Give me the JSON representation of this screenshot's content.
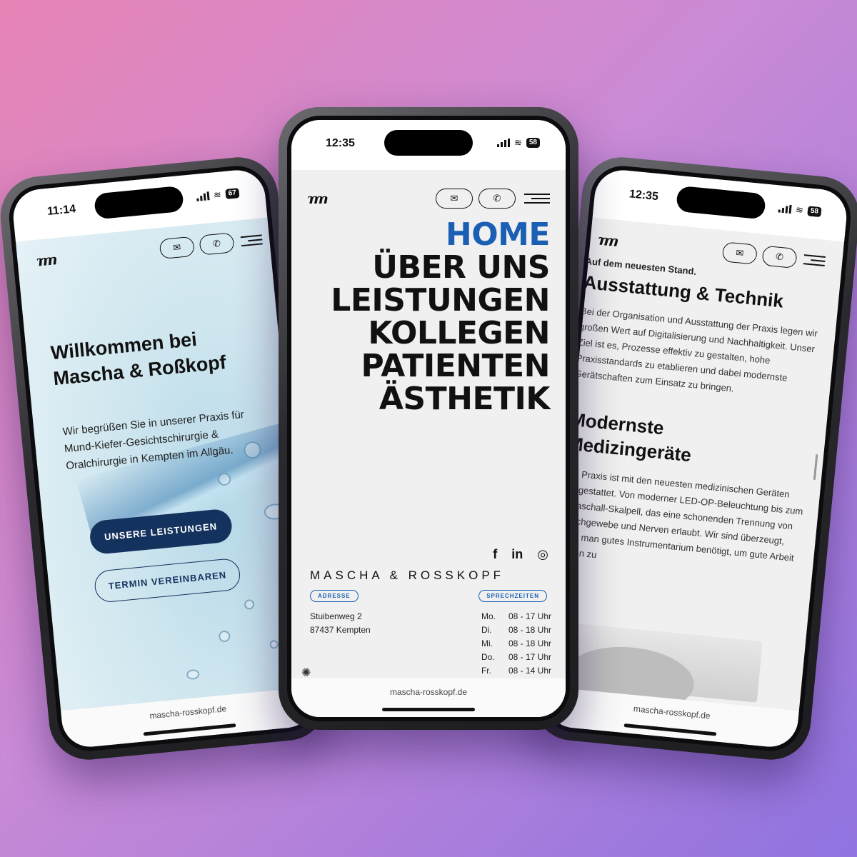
{
  "background": {
    "gradient_from": "#e784b6",
    "gradient_to": "#8f73e0"
  },
  "phones": {
    "left": {
      "status_time": "11:14",
      "battery": "67",
      "logo_text": "ɿɿɿɿ",
      "title_line1": "Willkommen bei",
      "title_line2": "Mascha & Roßkopf",
      "intro": "Wir begrüßen Sie in unserer Praxis für Mund-Kiefer-Gesichtschirurgie & Oralchirurgie in Kempten im Allgäu.",
      "primary_button": "UNSERE LEISTUNGEN",
      "secondary_button": "TERMIN VEREINBAREN",
      "url": "mascha-rosskopf.de"
    },
    "center": {
      "status_time": "12:35",
      "battery": "58",
      "logo_text": "ɿɿɿɿ",
      "nav": [
        "HOME",
        "ÜBER UNS",
        "LEISTUNGEN",
        "KOLLEGEN",
        "PATIENTEN",
        "ÄSTHETIK"
      ],
      "active_nav": "HOME",
      "accent_color": "#1a5fb4",
      "social": [
        "f",
        "in",
        "◎"
      ],
      "brand": "MASCHA & ROSSKOPF",
      "address_badge": "ADRESSE",
      "hours_badge": "SPRECHZEITEN",
      "address_line1": "Stuibenweg 2",
      "address_line2": "87437 Kempten",
      "hours": [
        {
          "day": "Mo.",
          "time": "08 - 17 Uhr"
        },
        {
          "day": "Di.",
          "time": "08 - 18 Uhr"
        },
        {
          "day": "Mi.",
          "time": "08 - 18 Uhr"
        },
        {
          "day": "Do.",
          "time": "08 - 17 Uhr"
        },
        {
          "day": "Fr.",
          "time": "08 - 14 Uhr"
        }
      ],
      "url": "mascha-rosskopf.de"
    },
    "right": {
      "status_time": "12:35",
      "battery": "58",
      "logo_text": "ɿɿɿɿ",
      "kicker": "Auf dem neuesten Stand.",
      "heading": "Ausstattung & Technik",
      "paragraph1": "Bei der Organisation und Ausstattung der Praxis legen wir großen Wert auf Digitalisierung und Nachhaltigkeit. Unser Ziel ist es, Prozesse effektiv zu gestalten, hohe Praxisstandards zu etablieren und dabei modernste Gerätschaften zum Einsatz zu bringen.",
      "heading2_line1": "Modernste",
      "heading2_line2": "Medizingeräte",
      "paragraph2": "Die Praxis ist mit den neuesten medizinischen Geräten ausgestattet. Von moderner LED-OP-Beleuchtung bis zum Ultraschall-Skalpell, das eine schonenden Trennung von Weichgewebe und Nerven erlaubt. Wir sind überzeugt, dass man gutes Instrumentarium benötigt, um gute Arbeit leisten zu",
      "url": "mascha-rosskopf.de"
    }
  }
}
